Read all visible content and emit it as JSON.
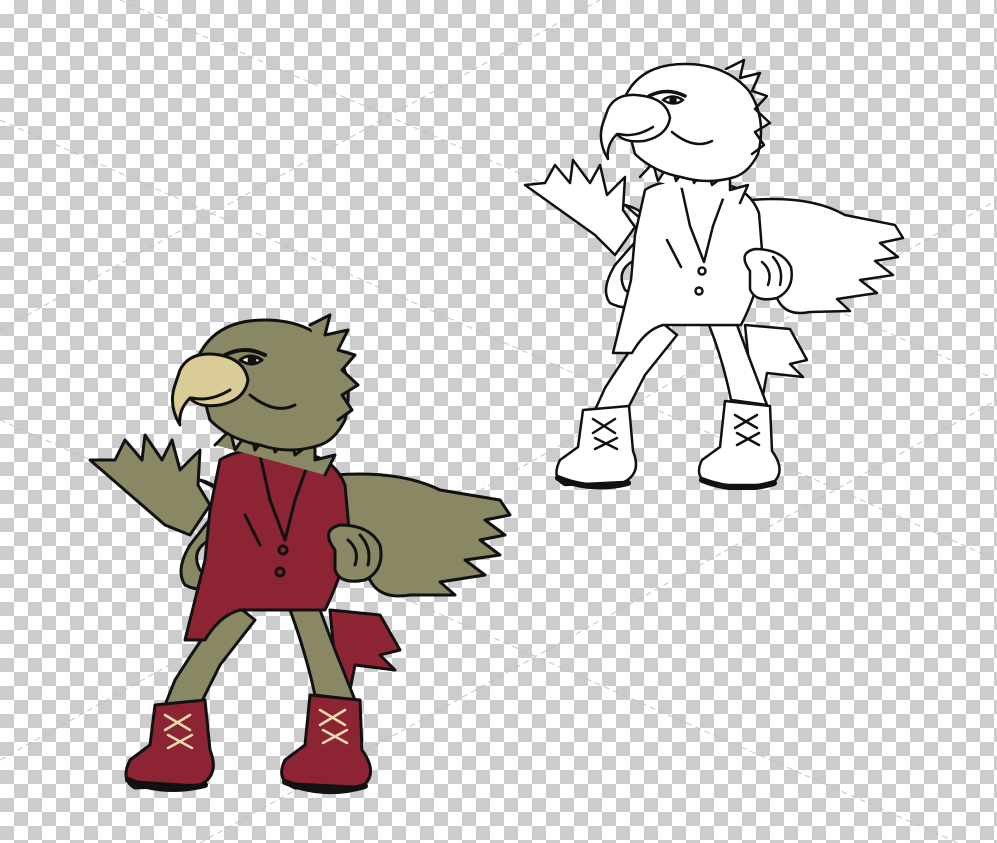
{
  "colors": {
    "feather": "#8a8764",
    "feather_dark": "#6f6c4d",
    "vest": "#8c2433",
    "beak": "#d9cc97",
    "outline": "#111111",
    "lace": "#e8dcb0",
    "sole": "#f2efe6",
    "checker_light": "#ffffff",
    "checker_dark": "#cccccc"
  },
  "icons": {
    "color_mascot": "eagle-mascot-color",
    "outline_mascot": "eagle-mascot-outline",
    "watermark": "diagonal-line-watermark"
  }
}
